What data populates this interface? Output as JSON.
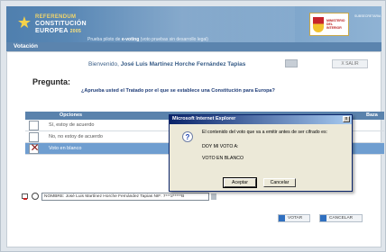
{
  "header": {
    "logo_line1": "REFERENDUM",
    "logo_line2": "CONSTITUCIÓN",
    "logo_line3": "EUROPEA",
    "logo_year": "2005",
    "tagline_prefix": "Prueba piloto de",
    "tagline_bold": "e-voting",
    "tagline_suffix": "(voto pruebas sin desarrollo legal)",
    "ministry": "MINISTERIO DEL INTERIOR",
    "subsecretaria": "SUBSECRETARIA",
    "colors": {
      "bar": "#5b84ae",
      "accent": "#f3d66a"
    }
  },
  "section": {
    "title": "Votación"
  },
  "welcome": {
    "prefix": "Bienvenido,",
    "name": "José Luis Martínez Horche Fernández Tapias"
  },
  "salir_label": "X SALIR",
  "pregunta_label": "Pregunta:",
  "question": "¿Aprueba usted el Tratado por el que se establece una Constitución para Europa?",
  "options_header": {
    "options": "Opciones",
    "right": "Baza"
  },
  "options": [
    {
      "label": "Sí, estoy de acuerdo",
      "selected": false
    },
    {
      "label": "No, no estoy de acuerdo",
      "selected": false
    },
    {
      "label": "Voto en blanco",
      "selected": true
    }
  ],
  "footer": {
    "field_value": "NOMBRE: José Luis Martínez Horche Fernández Tapias   NIF: 7***2*****B"
  },
  "buttons": {
    "votar": "VOTAR",
    "cancelar": "CANCELAR"
  },
  "dialog": {
    "title": "Microsoft Internet Explorer",
    "message": "El contenido del voto que va a emitir antes de ser cifrado es:",
    "line2": "DOY MI VOTO A:",
    "line3": "VOTO EN BLANCO",
    "accept": "Aceptar",
    "cancel": "Cancelar",
    "close": "x"
  }
}
